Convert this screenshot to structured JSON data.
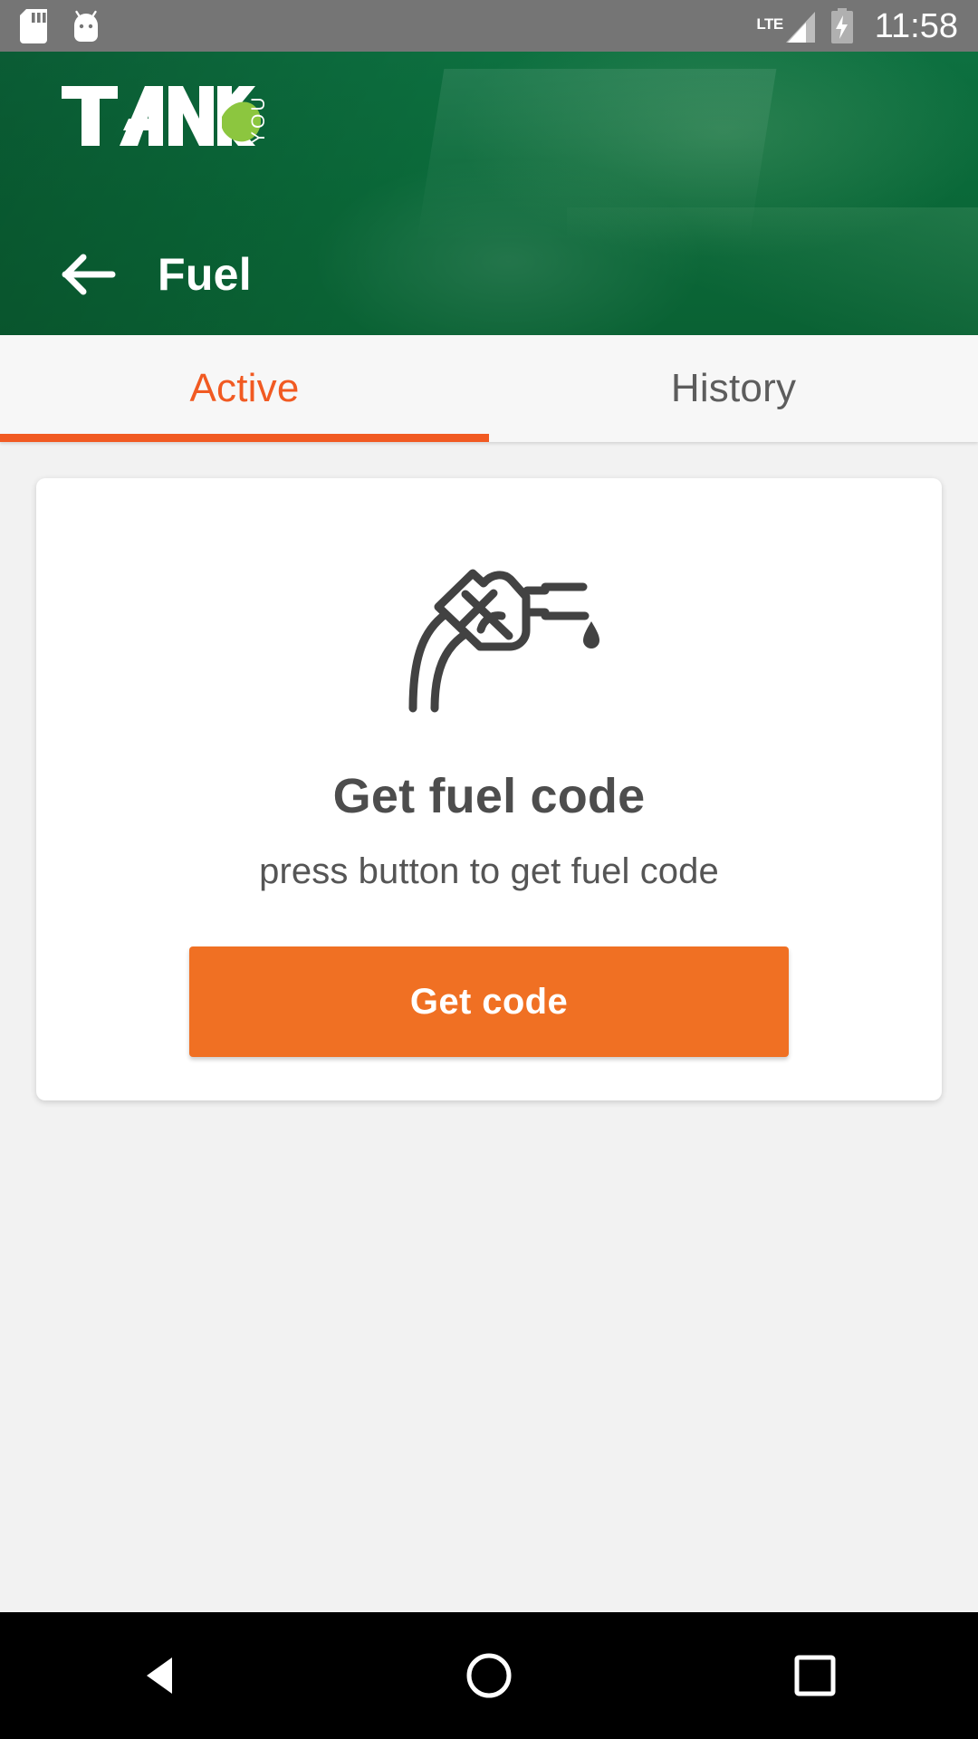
{
  "status_bar": {
    "background": "#757575",
    "icons": [
      "sd-card-icon",
      "android-bugdroid-icon",
      "lte-signal-icon",
      "battery-charging-icon"
    ],
    "lte_label": "LTE",
    "clock": "11:58"
  },
  "header": {
    "background": "#0b6b3a",
    "logo": {
      "brand": "TANK",
      "suffix": "YOU",
      "dot_color": "#8cc63f"
    },
    "back_icon": "arrow-left-icon",
    "title": "Fuel"
  },
  "tabs": {
    "active_color": "#f15a22",
    "inactive_color": "#5d5d5d",
    "items": [
      {
        "label": "Active",
        "selected": true
      },
      {
        "label": "History",
        "selected": false
      }
    ]
  },
  "card": {
    "icon": "fuel-nozzle-icon",
    "title": "Get fuel code",
    "subtitle": "press button to get fuel code",
    "button": {
      "label": "Get code",
      "color": "#f07023"
    }
  },
  "nav_bar": {
    "background": "#000000",
    "buttons": [
      "back-triangle-icon",
      "home-circle-icon",
      "recents-square-icon"
    ]
  }
}
